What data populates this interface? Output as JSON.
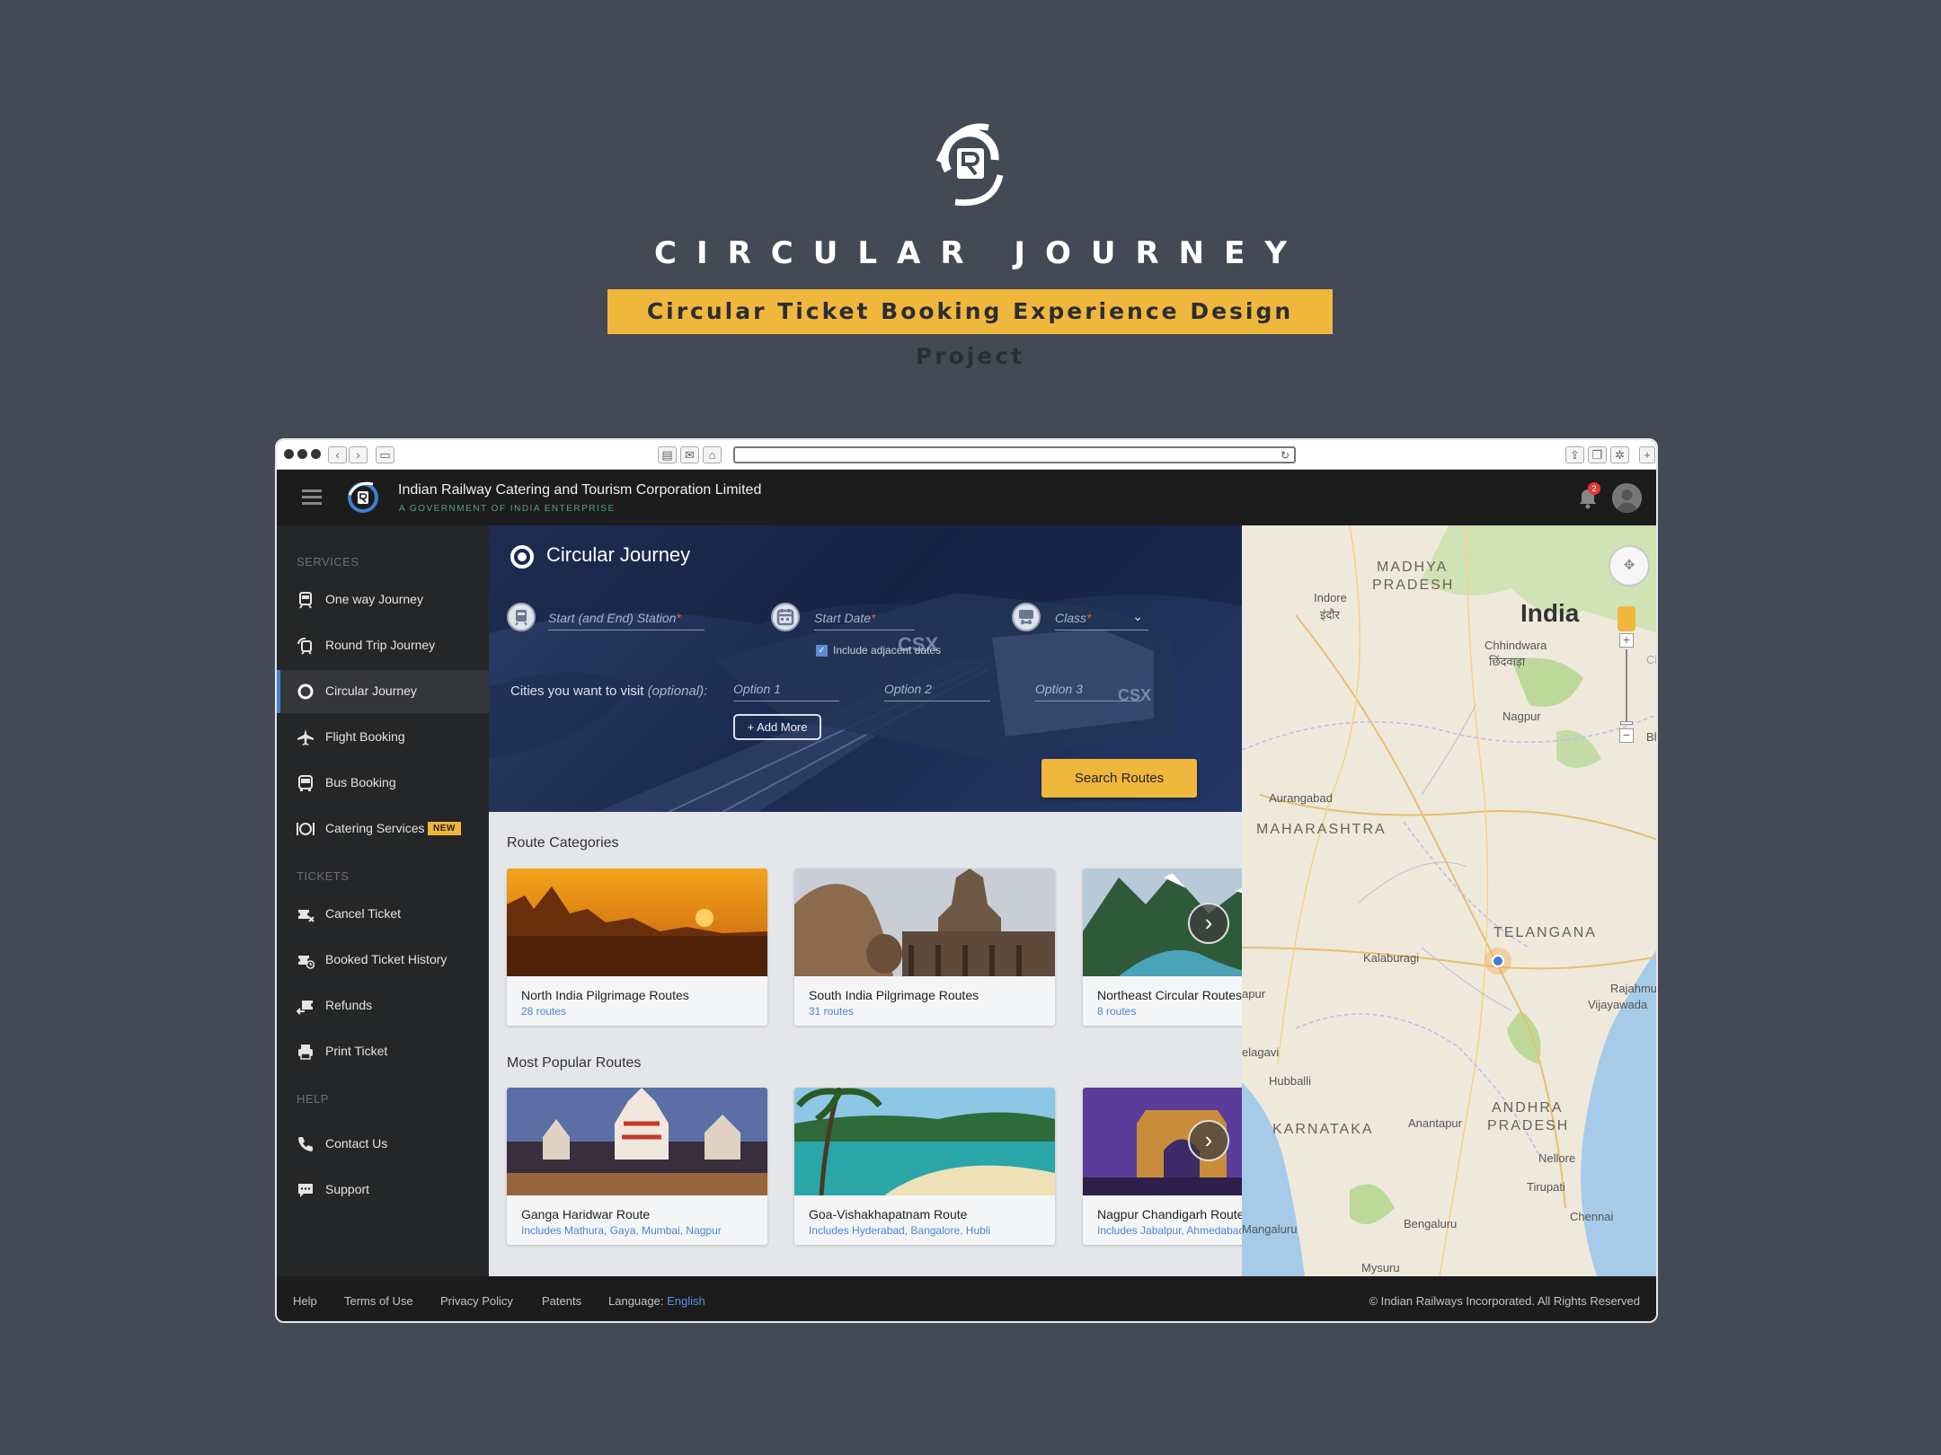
{
  "hero": {
    "title": "CIRCULAR JOURNEY",
    "subtitle": "Circular Ticket Booking Experience Design Project"
  },
  "browser": {
    "back": "‹",
    "forward": "›",
    "reload": "↻",
    "new_tab": "+"
  },
  "header": {
    "org_name": "Indian Railway Catering and Tourism Corporation Limited",
    "org_sub": "A GOVERNMENT OF INDIA ENTERPRISE",
    "notification_count": "2"
  },
  "sidebar": {
    "services_label": "SERVICES",
    "tickets_label": "TICKETS",
    "help_label": "HELP",
    "services": [
      {
        "label": "One way Journey",
        "icon": "train-icon"
      },
      {
        "label": "Round Trip Journey",
        "icon": "round-trip-icon"
      },
      {
        "label": "Circular Journey",
        "icon": "circle-icon",
        "active": true
      },
      {
        "label": "Flight Booking",
        "icon": "plane-icon"
      },
      {
        "label": "Bus Booking",
        "icon": "bus-icon"
      },
      {
        "label": "Catering Services",
        "icon": "plate-icon",
        "badge": "NEW"
      }
    ],
    "tickets": [
      {
        "label": "Cancel Ticket",
        "icon": "cancel-ticket-icon"
      },
      {
        "label": "Booked Ticket History",
        "icon": "ticket-history-icon"
      },
      {
        "label": "Refunds",
        "icon": "refund-icon"
      },
      {
        "label": "Print Ticket",
        "icon": "printer-icon"
      }
    ],
    "help": [
      {
        "label": "Contact Us",
        "icon": "phone-icon"
      },
      {
        "label": "Support",
        "icon": "chat-icon"
      }
    ]
  },
  "journey_form": {
    "title": "Circular Journey",
    "station_placeholder": "Start (and End) Station",
    "date_placeholder": "Start Date",
    "class_placeholder": "Class",
    "required_mark": "*",
    "adjacent_dates_label": "Include adjacent dates",
    "adjacent_dates_checked": true,
    "cities_label": "Cities you want to visit ",
    "cities_optional": "(optional):",
    "options": [
      "Option 1",
      "Option 2",
      "Option 3"
    ],
    "add_more": "Add More",
    "search_button": "Search Routes"
  },
  "route_categories": {
    "heading": "Route Categories",
    "items": [
      {
        "title": "North India Pilgrimage Routes",
        "subtitle": "28 routes"
      },
      {
        "title": "South India Pilgrimage Routes",
        "subtitle": "31 routes"
      },
      {
        "title": "Northeast Circular Routes",
        "subtitle": "8 routes"
      }
    ]
  },
  "popular_routes": {
    "heading": "Most Popular Routes",
    "items": [
      {
        "title": "Ganga Haridwar Route",
        "subtitle": "Includes Mathura, Gaya, Mumbai, Nagpur"
      },
      {
        "title": "Goa-Vishakhapatnam Route",
        "subtitle": "Includes Hyderabad, Bangalore, Hubli"
      },
      {
        "title": "Nagpur Chandigarh Route",
        "subtitle": "Includes Jabalpur, Ahmedabad"
      }
    ]
  },
  "map": {
    "country": "India",
    "states": [
      "MADHYA",
      "PRADESH",
      "MAHARASHTRA",
      "TELANGANA",
      "ANDHRA",
      "PRADESH",
      "KARNATAKA"
    ],
    "cities": [
      "Indore",
      "इंदौर",
      "Chhindwara",
      "छिंदवाड़ा",
      "Nagpur",
      "Aurangabad",
      "Kalaburagi",
      "Rajahmu",
      "Vijayawada",
      "apur",
      "elagavi",
      "Hubballi",
      "Anantapur",
      "Nellore",
      "Tirupati",
      "Bengaluru",
      "Chennai",
      "Mangaluru",
      "Mysuru",
      "Bh",
      "Ch"
    ]
  },
  "footer": {
    "links": [
      "Help",
      "Terms of Use",
      "Privacy Policy",
      "Patents"
    ],
    "language_label": "Language: ",
    "language_value": "English",
    "copyright": "© Indian Railways Incorporated. All Rights Reserved"
  },
  "colors": {
    "accent": "#f0b73d",
    "link": "#4b84d6",
    "active_border": "#3f7fd0",
    "background": "#434955"
  }
}
